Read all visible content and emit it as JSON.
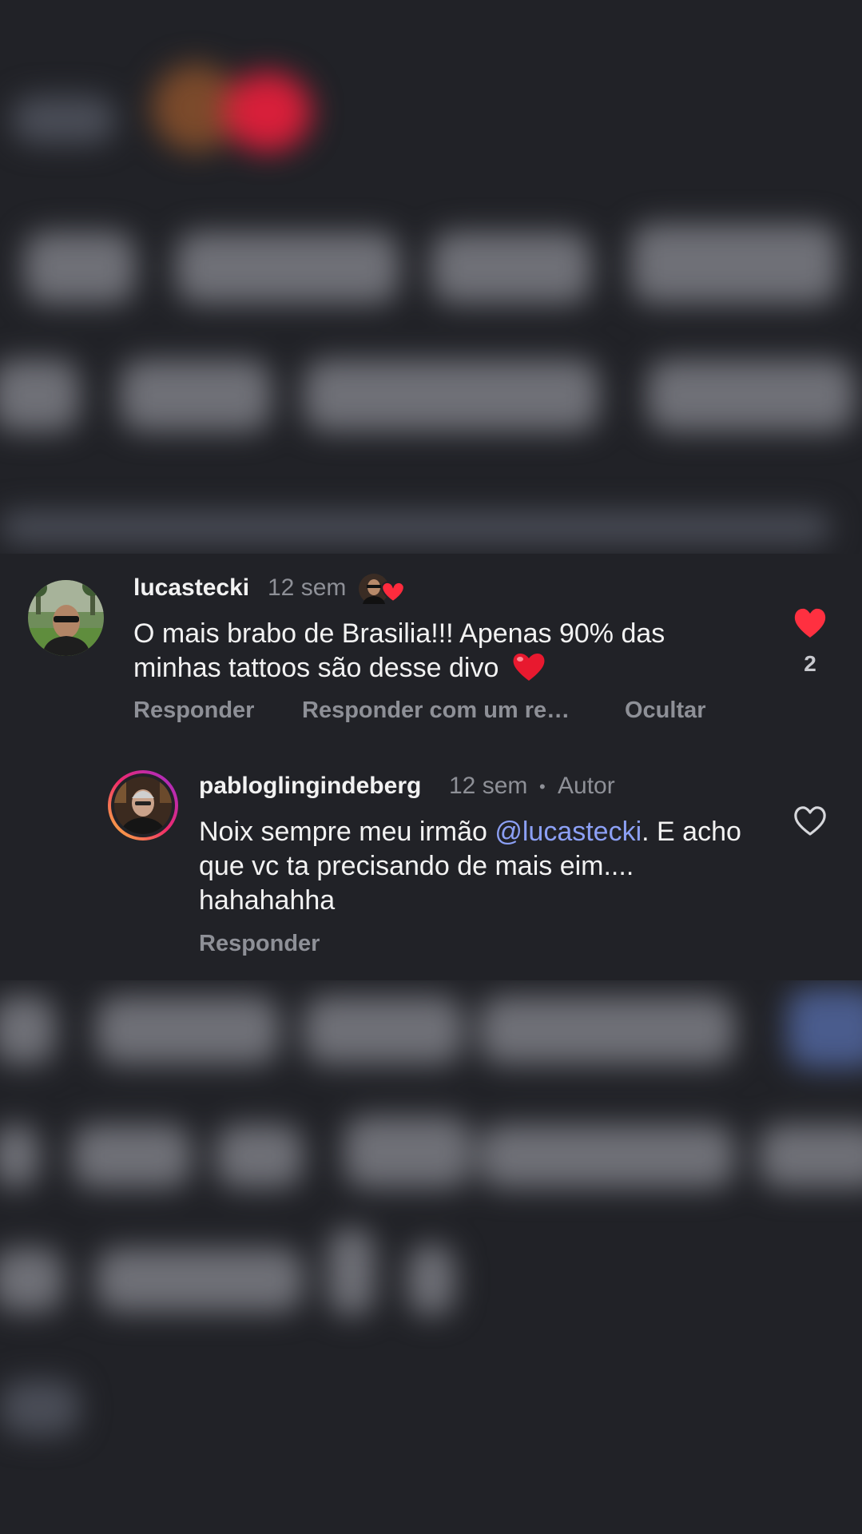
{
  "comment": {
    "username": "lucastecki",
    "time": "12 sem",
    "text": "O mais brabo de Brasilia!!! Apenas 90% das minhas tattoos são desse divo",
    "text_emoji": "red-heart-emoji",
    "like_count": "2",
    "liked": true,
    "reaction_badge": "author-liked-badge",
    "actions": {
      "reply": "Responder",
      "reply_with": "Responder com um re…",
      "hide": "Ocultar"
    }
  },
  "reply": {
    "username": "pabloglingindeberg",
    "time": "12 sem",
    "separator": "•",
    "author_label": "Autor",
    "text_before": "Noix sempre meu irmão ",
    "mention": "@lucastecki",
    "text_after": ". E acho que vc ta precisando de mais eim.... hahahahha",
    "liked": false,
    "actions": {
      "reply": "Responder"
    }
  },
  "colors": {
    "background": "#212227",
    "text": "#f2f2f2",
    "muted": "#8e9097",
    "mention": "#8ca0f5",
    "like_active": "#ff3040"
  }
}
